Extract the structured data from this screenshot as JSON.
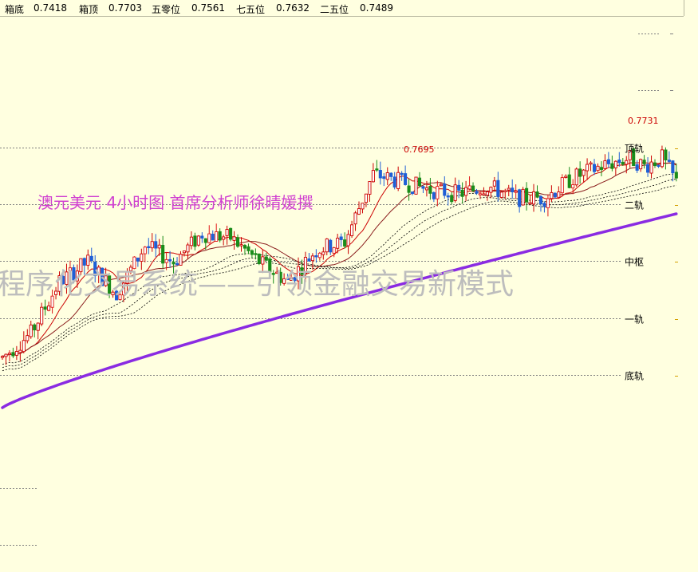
{
  "header": {
    "items": [
      {
        "label": "箱底",
        "value": "0.7418"
      },
      {
        "label": "箱顶",
        "value": "0.7703"
      },
      {
        "label": "五零位",
        "value": "0.7561"
      },
      {
        "label": "七五位",
        "value": "0.7632"
      },
      {
        "label": "二五位",
        "value": "0.7489"
      }
    ]
  },
  "overlay": {
    "title": "澳元美元 4小时图   首席分析师徐晴媛撰",
    "watermark": "程序化交易系统——引领金融交易新模式"
  },
  "colors": {
    "background": "#ffffe0",
    "bull_candle": "#cc0000",
    "bear_candle_blue": "#1f5fd6",
    "bear_candle_green": "#1a8c1a",
    "ma_fast": "#cc0000",
    "ma_slow": "#8a1c1c",
    "ma_long": "#8a2be2",
    "title_color": "#d040d0",
    "watermark_color": "#c8c8c8"
  },
  "chart_data": {
    "type": "candlestick",
    "symbol": "AUDUSD",
    "timeframe": "H4",
    "ylim": [
      0.7395,
      0.779
    ],
    "levels": [
      {
        "name": "顶轨",
        "value": 0.7703
      },
      {
        "name": "二轨",
        "value": 0.7632
      },
      {
        "name": "中枢",
        "value": 0.7561
      },
      {
        "name": "一轨",
        "value": 0.7489
      },
      {
        "name": "底轨",
        "value": 0.7418
      }
    ],
    "annotations": [
      {
        "text": "0.7695",
        "value": 0.7695
      },
      {
        "text": "0.7731",
        "value": 0.7731
      }
    ],
    "waypoints": [
      [
        0,
        0.744
      ],
      [
        8,
        0.747
      ],
      [
        16,
        0.7535
      ],
      [
        24,
        0.756
      ],
      [
        32,
        0.752
      ],
      [
        40,
        0.758
      ],
      [
        48,
        0.756
      ],
      [
        56,
        0.7595
      ],
      [
        64,
        0.759
      ],
      [
        72,
        0.756
      ],
      [
        80,
        0.7535
      ],
      [
        88,
        0.7575
      ],
      [
        96,
        0.7585
      ],
      [
        104,
        0.767
      ],
      [
        112,
        0.766
      ],
      [
        120,
        0.765
      ],
      [
        128,
        0.7645
      ],
      [
        136,
        0.7655
      ],
      [
        144,
        0.764
      ],
      [
        152,
        0.764
      ],
      [
        160,
        0.7665
      ],
      [
        168,
        0.768
      ],
      [
        176,
        0.769
      ],
      [
        180,
        0.768
      ],
      [
        185,
        0.769
      ],
      [
        189,
        0.766
      ]
    ]
  }
}
